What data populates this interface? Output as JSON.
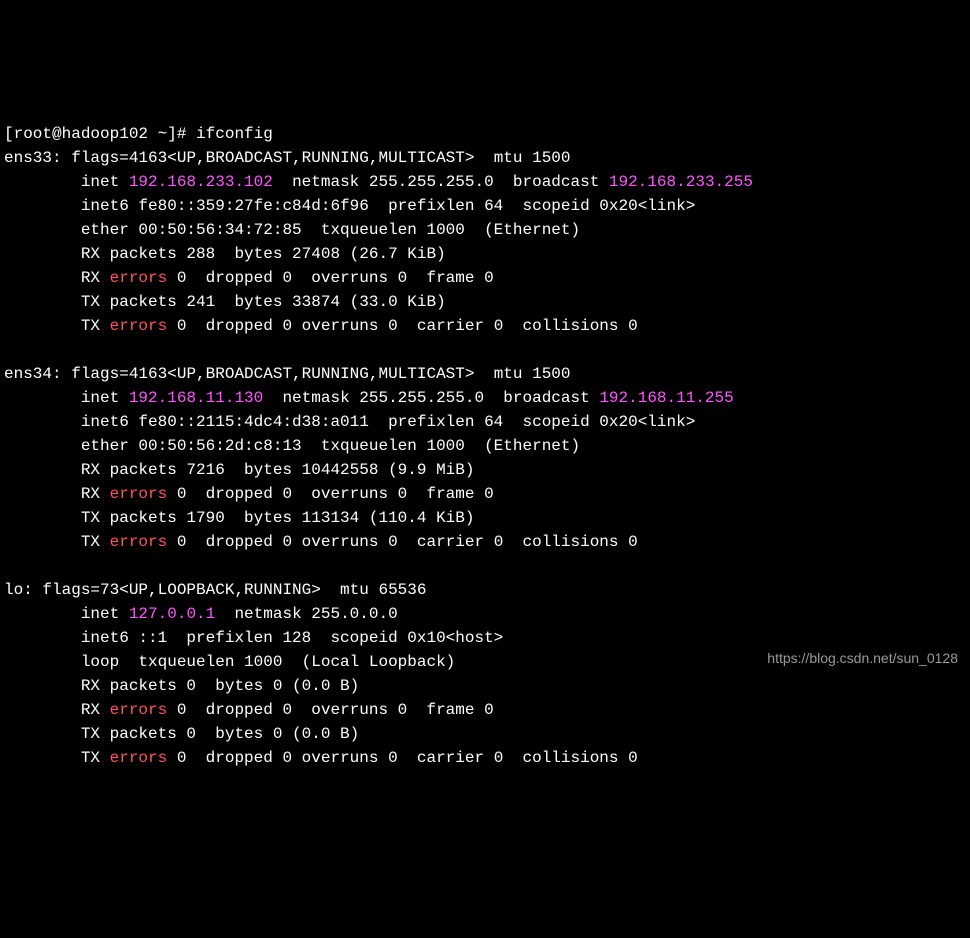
{
  "prompt": {
    "user_host": "[root@hadoop102 ~]# ",
    "command": "ifconfig"
  },
  "iface1": {
    "name": "ens33: ",
    "flags": "flags=4163<UP,BROADCAST,RUNNING,MULTICAST>  mtu 1500",
    "inet_label": "        inet ",
    "inet_addr": "192.168.233.102",
    "inet_rest": "  netmask 255.255.255.0  broadcast ",
    "broadcast": "192.168.233.255",
    "inet6": "        inet6 fe80::359:27fe:c84d:6f96  prefixlen 64  scopeid 0x20<link>",
    "ether": "        ether 00:50:56:34:72:85  txqueuelen 1000  (Ethernet)",
    "rx_packets": "        RX packets 288  bytes 27408 (26.7 KiB)",
    "rx_err_pre": "        RX ",
    "rx_err_word": "errors",
    "rx_err_post": " 0  dropped 0  overruns 0  frame 0",
    "tx_packets": "        TX packets 241  bytes 33874 (33.0 KiB)",
    "tx_err_pre": "        TX ",
    "tx_err_word": "errors",
    "tx_err_post": " 0  dropped 0 overruns 0  carrier 0  collisions 0"
  },
  "iface2": {
    "name": "ens34: ",
    "flags": "flags=4163<UP,BROADCAST,RUNNING,MULTICAST>  mtu 1500",
    "inet_label": "        inet ",
    "inet_addr": "192.168.11.130",
    "inet_rest": "  netmask 255.255.255.0  broadcast ",
    "broadcast": "192.168.11.255",
    "inet6": "        inet6 fe80::2115:4dc4:d38:a011  prefixlen 64  scopeid 0x20<link>",
    "ether": "        ether 00:50:56:2d:c8:13  txqueuelen 1000  (Ethernet)",
    "rx_packets": "        RX packets 7216  bytes 10442558 (9.9 MiB)",
    "rx_err_pre": "        RX ",
    "rx_err_word": "errors",
    "rx_err_post": " 0  dropped 0  overruns 0  frame 0",
    "tx_packets": "        TX packets 1790  bytes 113134 (110.4 KiB)",
    "tx_err_pre": "        TX ",
    "tx_err_word": "errors",
    "tx_err_post": " 0  dropped 0 overruns 0  carrier 0  collisions 0"
  },
  "iface3": {
    "name": "lo: ",
    "flags": "flags=73<UP,LOOPBACK,RUNNING>  mtu 65536",
    "inet_label": "        inet ",
    "inet_addr": "127.0.0.1",
    "inet_rest": "  netmask 255.0.0.0",
    "inet6": "        inet6 ::1  prefixlen 128  scopeid 0x10<host>",
    "loop": "        loop  txqueuelen 1000  (Local Loopback)",
    "rx_packets": "        RX packets 0  bytes 0 (0.0 B)",
    "rx_err_pre": "        RX ",
    "rx_err_word": "errors",
    "rx_err_post": " 0  dropped 0  overruns 0  frame 0",
    "tx_packets": "        TX packets 0  bytes 0 (0.0 B)",
    "tx_err_pre": "        TX ",
    "tx_err_word": "errors",
    "tx_err_post": " 0  dropped 0 overruns 0  carrier 0  collisions 0"
  },
  "watermark": "https://blog.csdn.net/sun_0128"
}
